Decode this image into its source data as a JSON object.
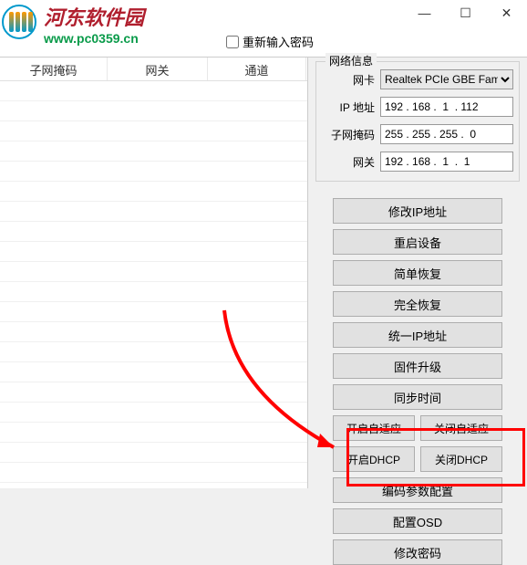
{
  "windowControls": {
    "min": "—",
    "max": "☐",
    "close": "✕"
  },
  "logo": {
    "title": "河东软件园",
    "url": "www.pc0359.cn"
  },
  "reenterPassword": {
    "label": "重新输入密码"
  },
  "table": {
    "headers": {
      "subnet": "子网掩码",
      "gateway": "网关",
      "channel": "通道"
    }
  },
  "networkInfo": {
    "legend": "网络信息",
    "nic": {
      "label": "网卡",
      "value": "Realtek PCIe GBE Fam"
    },
    "ip": {
      "label": "IP 地址",
      "value": "192 . 168 .  1  . 112"
    },
    "subnet": {
      "label": "子网掩码",
      "value": "255 . 255 . 255 .  0"
    },
    "gateway": {
      "label": "网关",
      "value": "192 . 168 .  1  .  1"
    }
  },
  "buttons": {
    "modifyIp": "修改IP地址",
    "restartDevice": "重启设备",
    "simpleRestore": "简单恢复",
    "fullRestore": "完全恢复",
    "unifyIp": "统一IP地址",
    "firmwareUpgrade": "固件升级",
    "syncTime": "同步时间",
    "enableAdaptive": "开启自适应",
    "disableAdaptive": "关闭自适应",
    "enableDhcp": "开启DHCP",
    "disableDhcp": "关闭DHCP",
    "codecConfig": "编码参数配置",
    "osdConfig": "配置OSD",
    "changePassword": "修改密码"
  }
}
